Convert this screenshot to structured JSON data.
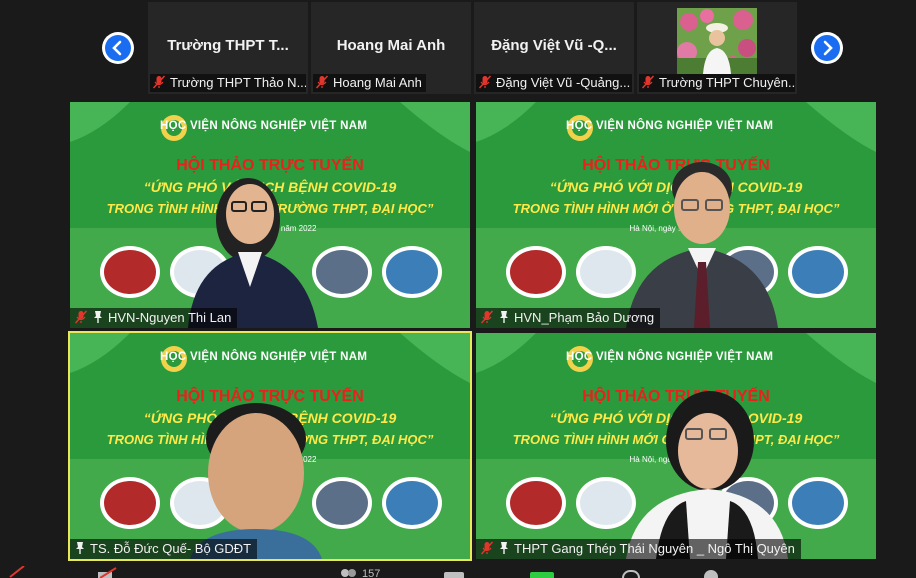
{
  "strip": {
    "participants": [
      {
        "name": "Trường THPT T...",
        "label": "Trường THPT Thảo N..."
      },
      {
        "name": "Hoang Mai Anh",
        "label": "Hoang Mai Anh"
      },
      {
        "name": "Đặng Việt Vũ -Q...",
        "label": "Đặng Việt Vũ -Quảng..."
      },
      {
        "name": "",
        "label": "Trường THPT Chuyên..."
      }
    ]
  },
  "slide": {
    "org": "HỌC VIỆN NÔNG NGHIỆP VIỆT NAM",
    "heading": "HỘI THẢO TRỰC TUYẾN",
    "line1": "“ỨNG PHÓ VỚI DỊCH BỆNH COVID-19",
    "line2": "TRONG TÌNH HÌNH MỚI Ở TRƯỜNG THPT, ĐẠI HỌC”",
    "date": "Hà Nội, ngày ... năm 2022"
  },
  "tiles": [
    {
      "label": "HVN-Nguyen Thi Lan"
    },
    {
      "label": "HVN_Phạm Bảo Dương"
    },
    {
      "label": "TS. Đỗ Đức Quế- Bộ GDĐT"
    },
    {
      "label": "THPT Gang Thép Thái Nguyên _ Ngô Thị Quyên"
    }
  ],
  "toolbar": {
    "participants_count": "157"
  },
  "colors": {
    "accent": "#1a6cf0",
    "active_speaker": "#e8e85a",
    "slide_green": "#2a9a3c",
    "heading_red": "#e8221b",
    "title_yellow": "#ffe94a",
    "mute_red": "#e0362c"
  }
}
